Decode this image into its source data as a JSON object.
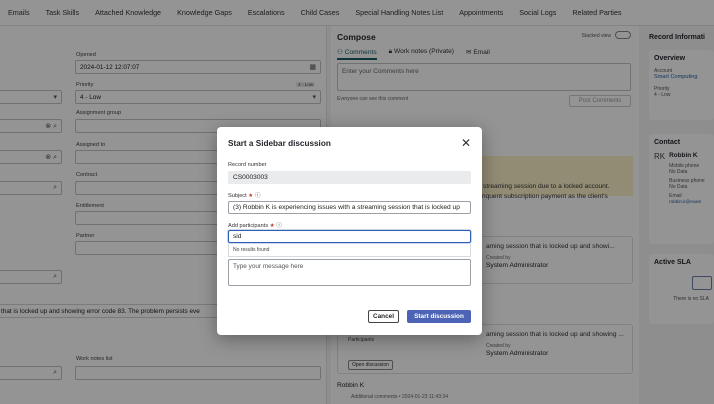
{
  "tabs": [
    "Emails",
    "Task Skills",
    "Attached Knowledge",
    "Knowledge Gaps",
    "Escalations",
    "Child Cases",
    "Special Handling Notes List",
    "Appointments",
    "Social Logs",
    "Related Parties"
  ],
  "form": {
    "opened_label": "Opened",
    "opened_value": "2024-01-12 12:07:07",
    "priority_label": "Priority",
    "priority_value": "4 - Low",
    "priority_badge": "4 - Low",
    "assignment_group_label": "Assignment group",
    "assigned_to_label": "Assigned to",
    "contract_label": "Contract",
    "entitlement_label": "Entitlement",
    "partner_label": "Partner",
    "description_text": "that is locked up and showing error code 83. The problem persists eve",
    "work_notes_list_label": "Work notes list"
  },
  "compose": {
    "title": "Compose",
    "stacked_view_label": "Stacked view",
    "tab_comments": "Comments",
    "tab_work_notes": "Work notes (Private)",
    "tab_email": "Email",
    "comments_placeholder": "Enter your Comments here",
    "visibility_note": "Everyone can see this comment",
    "post_button": "Post Comments",
    "banner_line1": "r streaming session due to a locked account.",
    "banner_line2": "linquent subscription payment as the client's",
    "card1_title": "aming session that is locked up and showi...",
    "card1_created_label": "Created by",
    "card1_created_by": "System Administrator",
    "card2_title": "aming session that is locked up and showing ...",
    "card2_created_label": "Created by",
    "card2_created_by": "System Administrator",
    "participants_label": "Participants",
    "open_discussion": "Open discussion",
    "last_author": "Robbin K",
    "last_meta": "Additional comments • 2024-01-23 11:43:34"
  },
  "record": {
    "title": "Record Informati",
    "overview": "Overview",
    "account_label": "Account",
    "account_value": "Smart Computing",
    "priority_label": "Priority",
    "priority_value": "4 - Low",
    "contact": "Contact",
    "contact_initials": "RK",
    "contact_name": "Robbin K",
    "mobile_label": "Mobile phone",
    "mobile_value": "No Data",
    "business_label": "Business phone",
    "business_value": "No Data",
    "email_label": "Email",
    "email_value": "robbin.k@exam",
    "active_sla": "Active SLA",
    "sla_empty": "There is no SLA"
  },
  "modal": {
    "title": "Start a Sidebar discussion",
    "record_number_label": "Record number",
    "record_number_value": "CS0003003",
    "subject_label": "Subject",
    "subject_value": "(3) Robbin K is experiencing issues with a streaming session that is locked up",
    "participants_label": "Add participants",
    "participants_value": "sid",
    "no_results": "No results found",
    "message_placeholder": "Type your message here",
    "cancel_label": "Cancel",
    "start_label": "Start discussion",
    "accent_color": "#4c63b6"
  }
}
